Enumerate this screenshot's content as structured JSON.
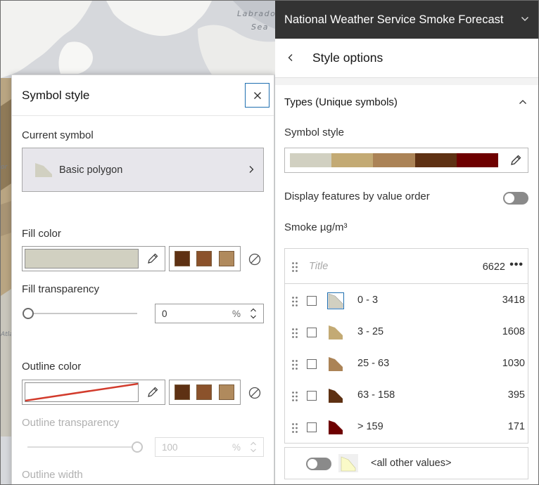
{
  "map": {
    "labels": [
      "Labrador",
      "Sea"
    ],
    "edge_labels": [
      "or",
      "Atla"
    ]
  },
  "symbol_style_panel": {
    "title": "Symbol style",
    "current_symbol_label": "Current symbol",
    "current_symbol_name": "Basic polygon",
    "fill_color_label": "Fill color",
    "fill_color": "#d1d0c1",
    "preset_swatches": [
      "#5e3113",
      "#8b522b",
      "#b08a5d"
    ],
    "fill_transparency_label": "Fill transparency",
    "fill_transparency_value": "0",
    "percent_unit": "%",
    "outline_color_label": "Outline color",
    "outline_color": "#d23b2c",
    "outline_transparency_label": "Outline transparency",
    "outline_transparency_value": "100",
    "outline_width_label": "Outline width"
  },
  "app_bar": {
    "title": "National Weather Service Smoke Forecast"
  },
  "style_options": {
    "title": "Style options",
    "types_title": "Types (Unique symbols)",
    "symbol_style_label": "Symbol style",
    "ramp_colors": [
      "#d1d0c1",
      "#c3aa74",
      "#ab8356",
      "#5e3113",
      "#6e0000"
    ],
    "display_order_label": "Display features by value order",
    "field_label": "Smoke µg/m³",
    "title_placeholder": "Title",
    "total_count": "6622",
    "classes": [
      {
        "label": "0 - 3",
        "count": "3418",
        "color": "#d1d0c1",
        "selected": true
      },
      {
        "label": "3 - 25",
        "count": "1608",
        "color": "#c3aa74",
        "selected": false
      },
      {
        "label": "25 - 63",
        "count": "1030",
        "color": "#ab8356",
        "selected": false
      },
      {
        "label": "63 - 158",
        "count": "395",
        "color": "#5e3113",
        "selected": false
      },
      {
        "label": "> 159",
        "count": "171",
        "color": "#6e0000",
        "selected": false
      }
    ],
    "other_values_label": "<all other values>",
    "other_values_color": "#fafac8"
  }
}
